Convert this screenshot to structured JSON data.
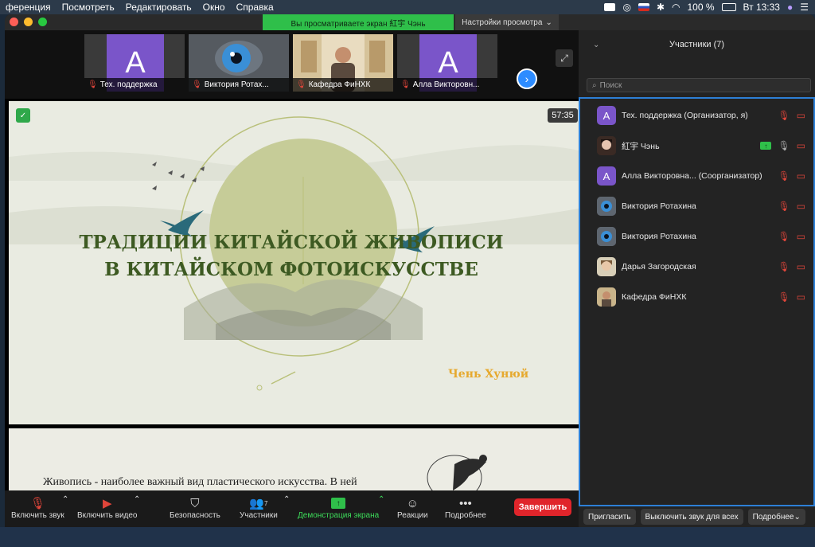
{
  "menubar": {
    "items": [
      "ференция",
      "Посмотреть",
      "Редактировать",
      "Окно",
      "Справка"
    ],
    "battery": "100 %",
    "clock": "Вт 13:33"
  },
  "titlebar": {
    "share_banner": "Вы просматриваете экран 紅宇 Чэнь",
    "view_settings": "Настройки просмотра"
  },
  "thumbnails": [
    {
      "name": "Тех. поддержка",
      "initial": "A"
    },
    {
      "name": "Виктория Ротах..."
    },
    {
      "name": "Кафедра ФиНХК"
    },
    {
      "name": "Алла Викторовн...",
      "initial": "A"
    }
  ],
  "stage": {
    "timer": "57:35",
    "slide_title_line1": "ТРАДИЦИИ КИТАЙСКОЙ ЖИВОПИСИ",
    "slide_title_line2": "В КИТАЙСКОМ ФОТОИСКУССТВЕ",
    "slide_author": "Чень Хунюй",
    "slide2_text": "Живопись  -  наиболее важный вид пластического искусства. В ней"
  },
  "toolbar": {
    "unmute": "Включить звук",
    "start_video": "Включить видео",
    "security": "Безопасность",
    "participants": "Участники",
    "participants_count": "7",
    "share_screen": "Демонстрация экрана",
    "reactions": "Реакции",
    "more": "Подробнее",
    "end": "Завершить"
  },
  "panel": {
    "title": "Участники (7)",
    "search_placeholder": "Поиск",
    "participants": [
      {
        "name": "Тех. поддержка (Организатор, я)",
        "initial": "A"
      },
      {
        "name": "紅宇 Чэнь"
      },
      {
        "name": "Алла Викторовна...    (Соорганизатор)",
        "initial": "A"
      },
      {
        "name": "Виктория Ротахина"
      },
      {
        "name": "Виктория Ротахина"
      },
      {
        "name": "Дарья Загородская"
      },
      {
        "name": "Кафедра ФиНХК"
      }
    ],
    "invite": "Пригласить",
    "mute_all": "Выключить звук для всех",
    "more": "Подробнее"
  },
  "colors": {
    "accent_green": "#2fbf4a",
    "accent_blue": "#2d8cff",
    "avatar_purple": "#7a55c9",
    "end_red": "#e0252b",
    "title_green": "#3d5a22",
    "author_gold": "#e6a92e"
  }
}
